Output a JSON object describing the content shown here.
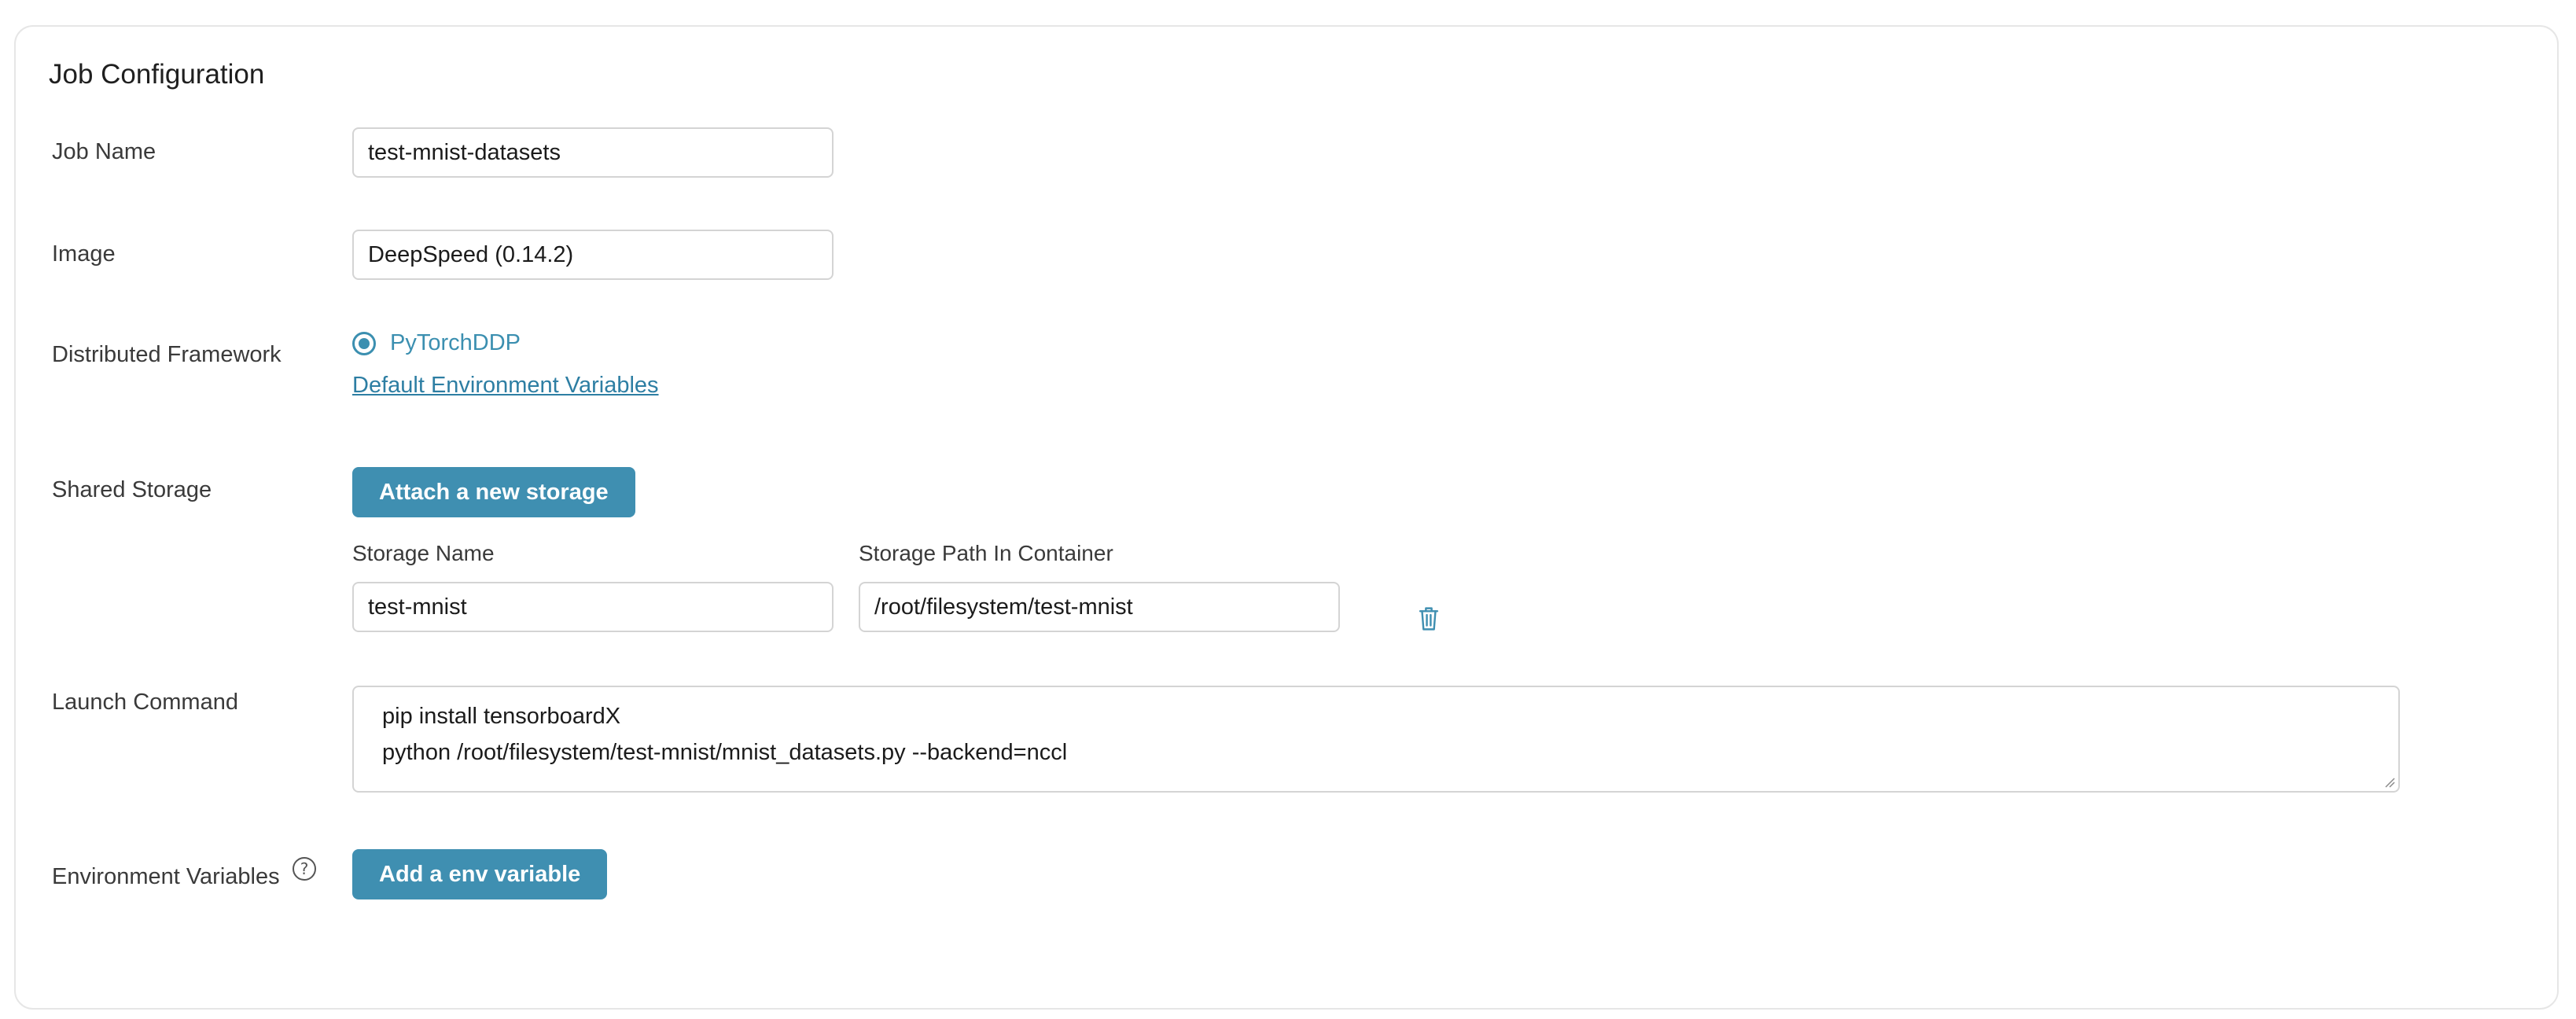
{
  "card": {
    "title": "Job Configuration"
  },
  "job_name": {
    "label": "Job Name",
    "value": "test-mnist-datasets"
  },
  "image": {
    "label": "Image",
    "value": "DeepSpeed (0.14.2)"
  },
  "framework": {
    "label": "Distributed Framework",
    "option": "PyTorchDDP",
    "selected": true,
    "env_link": "Default Environment Variables"
  },
  "storage": {
    "label": "Shared Storage",
    "attach_button": "Attach a new storage",
    "name_header": "Storage Name",
    "path_header": "Storage Path In Container",
    "name_value": "test-mnist",
    "path_value": "/root/filesystem/test-mnist",
    "delete_icon": "trash-icon"
  },
  "launch": {
    "label": "Launch Command",
    "lines": [
      "pip install tensorboardX",
      "python /root/filesystem/test-mnist/mnist_datasets.py --backend=nccl"
    ]
  },
  "env": {
    "label": "Environment Variables",
    "help_icon": "?",
    "add_button": "Add a env variable"
  },
  "colors": {
    "accent": "#3f8fb1",
    "link": "#2d7ea3",
    "border": "#d4d4d4"
  }
}
